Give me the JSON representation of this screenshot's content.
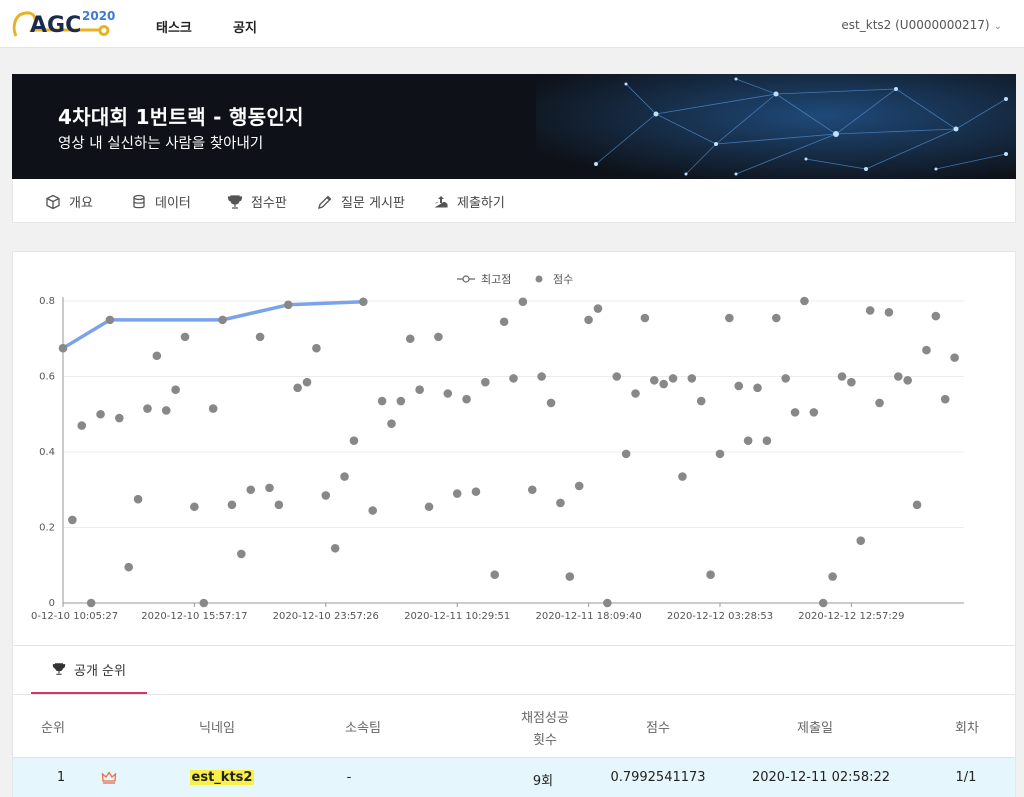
{
  "brand": {
    "logo_text": "AGC",
    "logo_year": "2020"
  },
  "nav": {
    "task": "태스크",
    "notice": "공지"
  },
  "user": {
    "label": "est_kts2 (U0000000217)"
  },
  "banner": {
    "title": "4차대회 1번트랙 - 행동인지",
    "subtitle": "영상 내 실신하는 사람을 찾아내기"
  },
  "tabs": [
    {
      "label": "개요",
      "icon": "cube-icon"
    },
    {
      "label": "데이터",
      "icon": "database-icon"
    },
    {
      "label": "점수판",
      "icon": "trophy-icon"
    },
    {
      "label": "질문 게시판",
      "icon": "pencil-icon"
    },
    {
      "label": "제출하기",
      "icon": "upload-icon"
    }
  ],
  "chart_data": {
    "type": "scatter",
    "series": [
      {
        "name": "최고점",
        "kind": "line",
        "color": "#7ba3ec",
        "points": [
          [
            0,
            0.675
          ],
          [
            5,
            0.75
          ],
          [
            17,
            0.75
          ],
          [
            24,
            0.79
          ],
          [
            32,
            0.798
          ]
        ]
      },
      {
        "name": "점수",
        "kind": "scatter",
        "color": "#888888",
        "values": [
          0.675,
          0.22,
          0.47,
          0.0,
          0.5,
          0.75,
          0.49,
          0.095,
          0.275,
          0.515,
          0.655,
          0.51,
          0.565,
          0.705,
          0.255,
          0.0,
          0.515,
          0.75,
          0.26,
          0.13,
          0.3,
          0.705,
          0.305,
          0.26,
          0.79,
          0.57,
          0.585,
          0.675,
          0.285,
          0.145,
          0.335,
          0.43,
          0.798,
          0.245,
          0.535,
          0.475,
          0.535,
          0.7,
          0.565,
          0.255,
          0.705,
          0.555,
          0.29,
          0.54,
          0.295,
          0.585,
          0.075,
          0.745,
          0.595,
          0.798,
          0.3,
          0.6,
          0.53,
          0.265,
          0.07,
          0.31,
          0.75,
          0.78,
          0.0,
          0.6,
          0.395,
          0.555,
          0.755,
          0.59,
          0.58,
          0.595,
          0.335,
          0.595,
          0.535,
          0.075,
          0.395,
          0.755,
          0.575,
          0.43,
          0.57,
          0.43,
          0.755,
          0.595,
          0.505,
          0.8,
          0.505,
          0.0,
          0.07,
          0.6,
          0.585,
          0.165,
          0.775,
          0.53,
          0.77,
          0.6,
          0.59,
          0.26,
          0.67,
          0.76,
          0.54,
          0.65
        ]
      }
    ],
    "x_tick_labels": [
      "0-12-10 10:05:27",
      "2020-12-10 15:57:17",
      "2020-12-10 23:57:26",
      "2020-12-11 10:29:51",
      "2020-12-11 18:09:40",
      "2020-12-12 03:28:53",
      "2020-12-12 12:57:29"
    ],
    "y_ticks": [
      "0",
      "0.2",
      "0.4",
      "0.6",
      "0.8"
    ],
    "ylim": [
      0,
      0.8
    ],
    "legend": [
      "최고점",
      "점수"
    ],
    "legend_position": "top-center",
    "grid": true
  },
  "leaderboard": {
    "tab_label": "공개 순위",
    "headers": {
      "rank": "순위",
      "nickname": "닉네임",
      "team": "소속팀",
      "count_line1": "채점성공",
      "count_line2": "횟수",
      "score": "점수",
      "date": "제출일",
      "round": "회차"
    },
    "rows": [
      {
        "rank": "1",
        "nickname": "est_kts2",
        "team": "-",
        "count": "9회",
        "score": "0.7992541173",
        "date": "2020-12-11 02:58:22",
        "round": "1/1",
        "accent": "#e8704a"
      }
    ]
  }
}
